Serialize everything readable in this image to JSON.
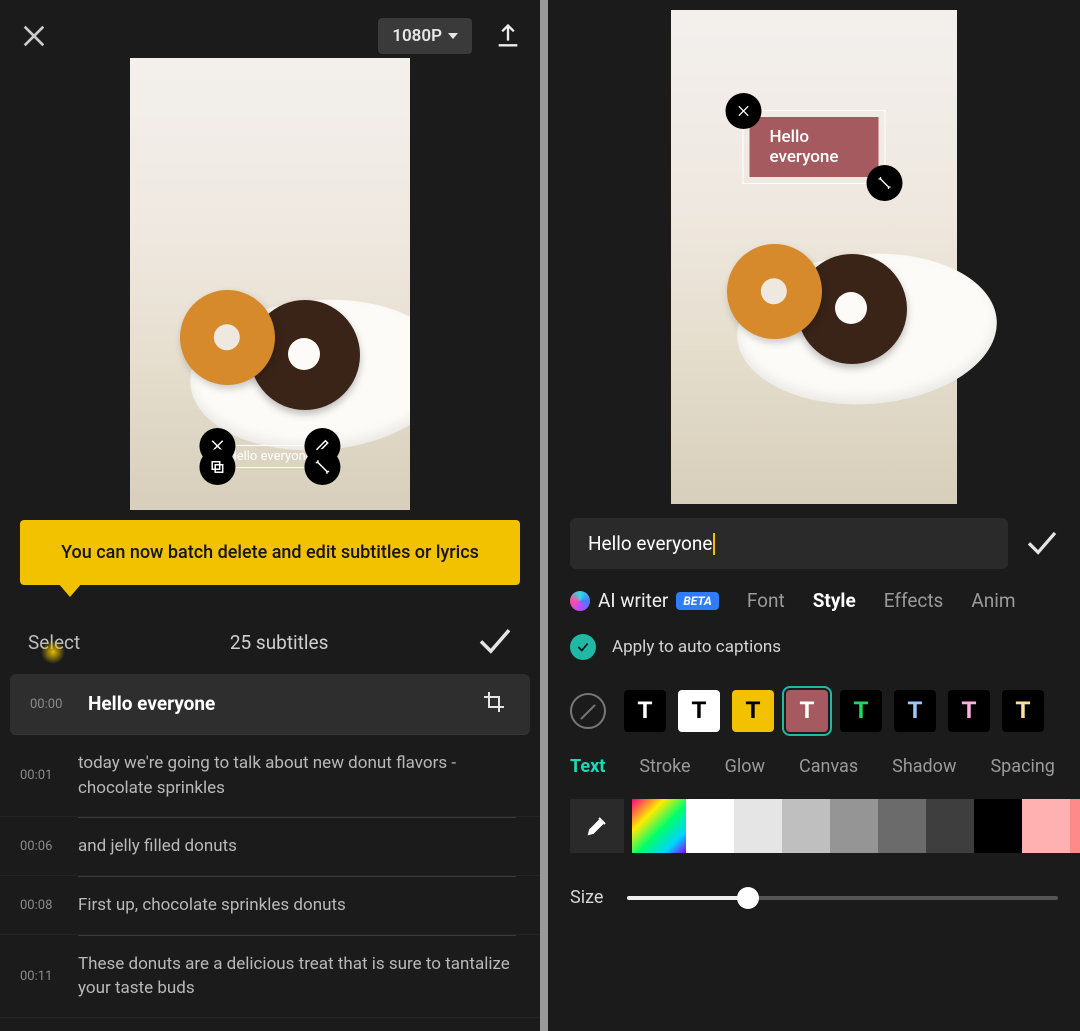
{
  "left": {
    "resolution": "1080P",
    "preview_subtitle": "Hello everyone",
    "tooltip": "You can now batch delete and edit subtitles or lyrics",
    "select_label": "Select",
    "count_label": "25 subtitles",
    "subtitles": [
      {
        "time": "00:00",
        "text": "Hello everyone",
        "active": true
      },
      {
        "time": "00:01",
        "text": "today we're going to talk about new donut flavors - chocolate sprinkles"
      },
      {
        "time": "00:06",
        "text": "and jelly filled donuts"
      },
      {
        "time": "00:08",
        "text": "First up, chocolate sprinkles donuts"
      },
      {
        "time": "00:11",
        "text": "These donuts are a delicious treat that is sure to tantalize your taste buds"
      }
    ]
  },
  "right": {
    "preview_subtitle": "Hello everyone",
    "input_text": "Hello everyone",
    "tabs": {
      "ai_writer": "AI writer",
      "beta": "BETA",
      "font": "Font",
      "style": "Style",
      "effects": "Effects",
      "anim": "Anim"
    },
    "apply_label": "Apply to auto captions",
    "style_swatches": [
      {
        "bg": "#000000",
        "fg": "#ffffff",
        "label": "T"
      },
      {
        "bg": "#ffffff",
        "fg": "#000000",
        "label": "T"
      },
      {
        "bg": "#f2c200",
        "fg": "#000000",
        "label": "T"
      },
      {
        "bg": "#a45a5e",
        "fg": "#ffffff",
        "label": "T",
        "selected": true
      },
      {
        "bg": "#000000",
        "fg": "#1fd862",
        "label": "T"
      },
      {
        "bg": "#000000",
        "fg": "#9ec7ff",
        "label": "T"
      },
      {
        "bg": "#000000",
        "fg": "#ffb0e0",
        "label": "T"
      },
      {
        "bg": "#000000",
        "fg": "#ffe0a0",
        "label": "T"
      }
    ],
    "subtabs": {
      "text": "Text",
      "stroke": "Stroke",
      "glow": "Glow",
      "canvas": "Canvas",
      "shadow": "Shadow",
      "spacing": "Spacing"
    },
    "colors": [
      "#ffffff",
      "#e5e5e5",
      "#bfbfbf",
      "#959595",
      "#6b6b6b",
      "#3e3e3e",
      "#000000",
      "#ffb0b0",
      "#ff8a8a",
      "#ff6a6a",
      "#ff4040",
      "#ff1010"
    ],
    "size_label": "Size",
    "size_percent": 28
  }
}
